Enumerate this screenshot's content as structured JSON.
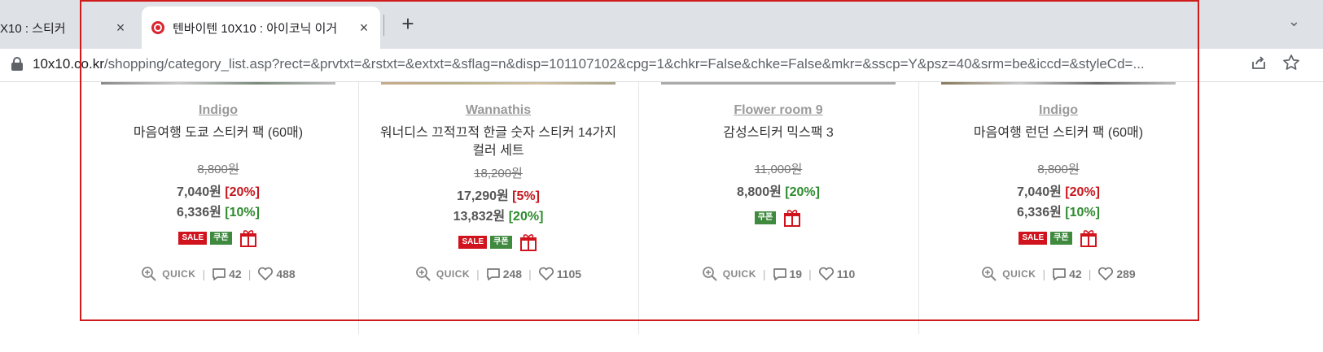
{
  "browser": {
    "tabs": [
      {
        "label": "X10 : 스티커"
      },
      {
        "label": "텐바이텐 10X10 : 아이코닉 이거"
      }
    ],
    "close_label": "×",
    "newtab_label": "+",
    "menu_label": "⌄",
    "url_host": "10x10.co.kr",
    "url_path": "/shopping/category_list.asp?rect=&prvtxt=&rstxt=&extxt=&sflag=n&disp=101107102&cpg=1&chkr=False&chke=False&mkr=&sscp=Y&psz=40&srm=be&iccd=&styleCd=..."
  },
  "badges": {
    "sale": "SALE",
    "coupon": "쿠폰"
  },
  "quick_label": "QUICK",
  "products": [
    {
      "brand": "Indigo",
      "name": "마음여행 도쿄 스티커 팩 (60매)",
      "orig_price": "8,800원",
      "prices": [
        {
          "amount": "7,040원",
          "pct": "[20%]",
          "pct_color": "red"
        },
        {
          "amount": "6,336원",
          "pct": "[10%]",
          "pct_color": "green"
        }
      ],
      "show_sale": true,
      "reviews": "42",
      "likes": "488"
    },
    {
      "brand": "Wannathis",
      "name": "워너디스 끄적끄적 한글 숫자 스티커 14가지 컬러 세트",
      "orig_price": "18,200원",
      "prices": [
        {
          "amount": "17,290원",
          "pct": "[5%]",
          "pct_color": "red"
        },
        {
          "amount": "13,832원",
          "pct": "[20%]",
          "pct_color": "green"
        }
      ],
      "show_sale": true,
      "reviews": "248",
      "likes": "1105"
    },
    {
      "brand": "Flower room 9",
      "name": "감성스티커 믹스팩 3",
      "orig_price": "11,000원",
      "prices": [
        {
          "amount": "8,800원",
          "pct": "[20%]",
          "pct_color": "green"
        }
      ],
      "show_sale": false,
      "reviews": "19",
      "likes": "110"
    },
    {
      "brand": "Indigo",
      "name": "마음여행 런던 스티커 팩 (60매)",
      "orig_price": "8,800원",
      "prices": [
        {
          "amount": "7,040원",
          "pct": "[20%]",
          "pct_color": "red"
        },
        {
          "amount": "6,336원",
          "pct": "[10%]",
          "pct_color": "green"
        }
      ],
      "show_sale": true,
      "reviews": "42",
      "likes": "289"
    }
  ]
}
